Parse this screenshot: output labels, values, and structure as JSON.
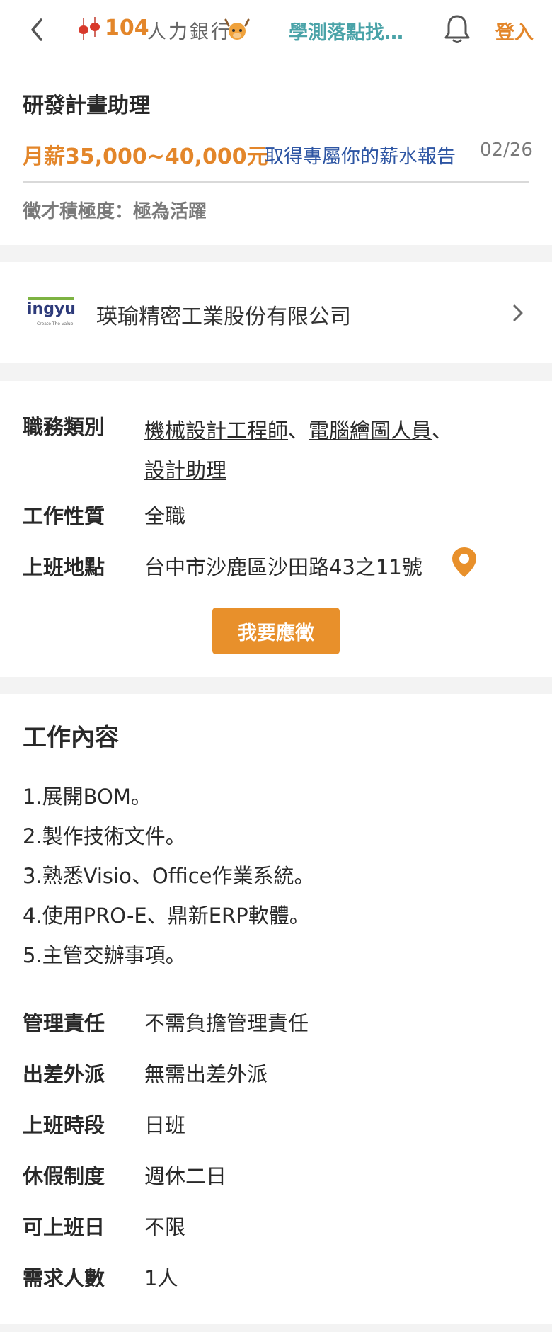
{
  "topbar": {
    "logo_text": "人力銀行",
    "logo_number": "104",
    "banner_link": "學測落點找…",
    "login": "登入",
    "colors": {
      "accent": "#e3862a",
      "teal": "#4aa3a8"
    }
  },
  "job": {
    "title": "研發計畫助理",
    "salary": "月薪35,000~40,000元",
    "salary_report": "取得專屬你的薪水報告",
    "date": "02/26",
    "activity": "徵才積極度：極為活躍"
  },
  "company": {
    "logo_text": "ingyu",
    "logo_tagline": "Create The Value",
    "name": "瑛瑜精密工業股份有限公司"
  },
  "details": {
    "category_label": "職務類別",
    "categories": [
      "機械設計工程師",
      "電腦繪圖人員",
      "設計助理"
    ],
    "separator": "、",
    "type_label": "工作性質",
    "type_value": "全職",
    "location_label": "上班地點",
    "location_value": "台中市沙鹿區沙田路43之11號",
    "apply_button": "我要應徵"
  },
  "content": {
    "title": "工作內容",
    "duties": [
      "1.展開BOM。",
      "2.製作技術文件。",
      "3.熟悉Visio、Office作業系統。",
      "4.使用PRO-E、鼎新ERP軟體。",
      "5.主管交辦事項。"
    ],
    "attributes": [
      {
        "label": "管理責任",
        "value": "不需負擔管理責任"
      },
      {
        "label": "出差外派",
        "value": "無需出差外派"
      },
      {
        "label": "上班時段",
        "value": "日班"
      },
      {
        "label": "休假制度",
        "value": "週休二日"
      },
      {
        "label": "可上班日",
        "value": "不限"
      },
      {
        "label": "需求人數",
        "value": "1人"
      }
    ]
  }
}
